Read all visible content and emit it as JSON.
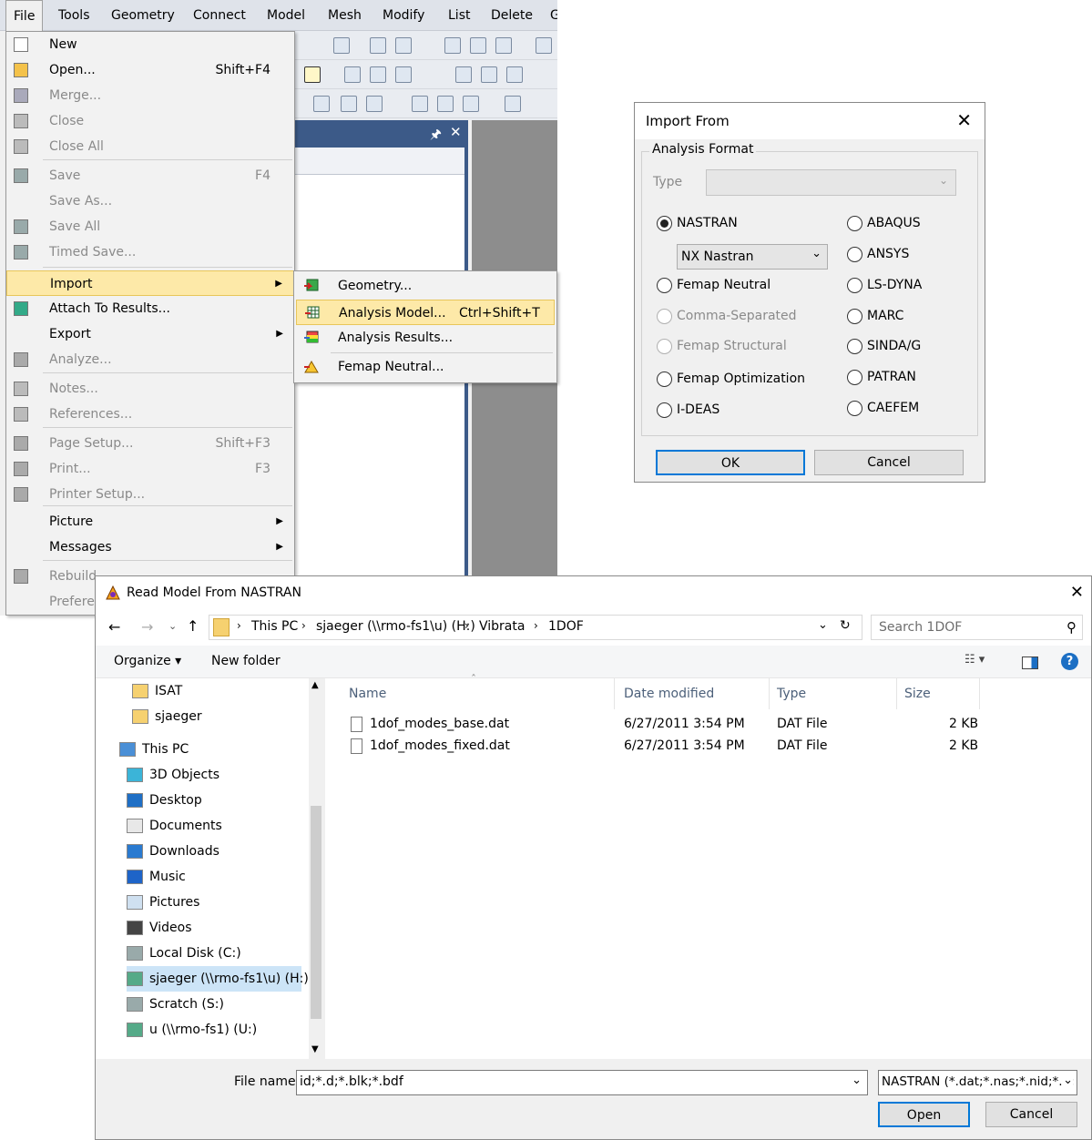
{
  "menubar": [
    "File",
    "Tools",
    "Geometry",
    "Connect",
    "Model",
    "Mesh",
    "Modify",
    "List",
    "Delete",
    "G"
  ],
  "file_menu": [
    {
      "label": "New",
      "shortcut": "",
      "disabled": false,
      "icon": "new-file-icon"
    },
    {
      "label": "Open...",
      "shortcut": "Shift+F4",
      "disabled": false,
      "icon": "open-folder-icon"
    },
    {
      "label": "Merge...",
      "shortcut": "",
      "disabled": true,
      "icon": "merge-icon"
    },
    {
      "label": "Close",
      "shortcut": "",
      "disabled": true,
      "icon": "close-folder-icon"
    },
    {
      "label": "Close All",
      "shortcut": "",
      "disabled": true,
      "icon": "close-all-icon"
    },
    {
      "label": "Save",
      "shortcut": "F4",
      "disabled": true,
      "icon": "save-icon"
    },
    {
      "label": "Save As...",
      "shortcut": "",
      "disabled": true,
      "icon": ""
    },
    {
      "label": "Save All",
      "shortcut": "",
      "disabled": true,
      "icon": "save-all-icon"
    },
    {
      "label": "Timed Save...",
      "shortcut": "",
      "disabled": true,
      "icon": "timed-save-icon"
    },
    {
      "label": "Import",
      "shortcut": "",
      "disabled": false,
      "icon": ""
    },
    {
      "label": "Attach To Results...",
      "shortcut": "",
      "disabled": false,
      "icon": "attach-results-icon"
    },
    {
      "label": "Export",
      "shortcut": "",
      "disabled": false,
      "icon": ""
    },
    {
      "label": "Analyze...",
      "shortcut": "",
      "disabled": true,
      "icon": "analyze-icon"
    },
    {
      "label": "Notes...",
      "shortcut": "",
      "disabled": true,
      "icon": "notes-icon"
    },
    {
      "label": "References...",
      "shortcut": "",
      "disabled": true,
      "icon": "references-icon"
    },
    {
      "label": "Page Setup...",
      "shortcut": "Shift+F3",
      "disabled": true,
      "icon": "page-setup-icon"
    },
    {
      "label": "Print...",
      "shortcut": "F3",
      "disabled": true,
      "icon": "print-icon"
    },
    {
      "label": "Printer Setup...",
      "shortcut": "",
      "disabled": true,
      "icon": "printer-setup-icon"
    },
    {
      "label": "Picture",
      "shortcut": "",
      "disabled": false,
      "icon": ""
    },
    {
      "label": "Messages",
      "shortcut": "",
      "disabled": false,
      "icon": ""
    },
    {
      "label": "Rebuild",
      "shortcut": "",
      "disabled": true,
      "icon": "rebuild-icon"
    },
    {
      "label": "Prefere",
      "shortcut": "",
      "disabled": true,
      "icon": ""
    }
  ],
  "import_submenu": [
    {
      "label": "Geometry...",
      "shortcut": ""
    },
    {
      "label": "Analysis Model...",
      "shortcut": "Ctrl+Shift+T"
    },
    {
      "label": "Analysis Results...",
      "shortcut": ""
    },
    {
      "label": "Femap Neutral...",
      "shortcut": ""
    }
  ],
  "import_dialog": {
    "title": "Import From",
    "group": "Analysis Format",
    "type_label": "Type",
    "selected": "NASTRAN",
    "nastran_variant": "NX Nastran",
    "left_options": [
      "NASTRAN",
      "Femap Neutral",
      "Comma-Separated",
      "Femap Structural",
      "Femap Optimization",
      "I-DEAS"
    ],
    "right_options": [
      "ABAQUS",
      "ANSYS",
      "LS-DYNA",
      "MARC",
      "SINDA/G",
      "PATRAN",
      "CAEFEM"
    ],
    "ok": "OK",
    "cancel": "Cancel"
  },
  "file_dialog": {
    "title": "Read Model From NASTRAN",
    "path": [
      "This PC",
      "sjaeger (\\\\rmo-fs1\\u) (H:)",
      "Vibrata",
      "1DOF"
    ],
    "search_placeholder": "Search 1DOF",
    "organize": "Organize ▾",
    "new_folder": "New folder",
    "tree": [
      {
        "label": "ISAT",
        "icon": "folder-icon"
      },
      {
        "label": "sjaeger",
        "icon": "folder-icon"
      },
      {
        "label": "This PC",
        "icon": "computer-icon"
      },
      {
        "label": "3D Objects",
        "icon": "3d-objects-icon"
      },
      {
        "label": "Desktop",
        "icon": "desktop-icon"
      },
      {
        "label": "Documents",
        "icon": "documents-icon"
      },
      {
        "label": "Downloads",
        "icon": "downloads-icon"
      },
      {
        "label": "Music",
        "icon": "music-icon"
      },
      {
        "label": "Pictures",
        "icon": "pictures-icon"
      },
      {
        "label": "Videos",
        "icon": "videos-icon"
      },
      {
        "label": "Local Disk (C:)",
        "icon": "drive-icon"
      },
      {
        "label": "sjaeger (\\\\rmo-fs1\\u) (H:)",
        "icon": "network-drive-icon"
      },
      {
        "label": "Scratch (S:)",
        "icon": "drive-icon"
      },
      {
        "label": "u (\\\\rmo-fs1) (U:)",
        "icon": "network-drive-icon"
      }
    ],
    "columns": [
      "Name",
      "Date modified",
      "Type",
      "Size"
    ],
    "files": [
      {
        "name": "1dof_modes_base.dat",
        "date": "6/27/2011 3:54 PM",
        "type": "DAT File",
        "size": "2 KB"
      },
      {
        "name": "1dof_modes_fixed.dat",
        "date": "6/27/2011 3:54 PM",
        "type": "DAT File",
        "size": "2 KB"
      }
    ],
    "filename_label": "File name:",
    "filename_value": "id;*.d;*.blk;*.bdf",
    "filter": "NASTRAN (*.dat;*.nas;*.nid;*.d;",
    "open": "Open",
    "cancel": "Cancel"
  },
  "colors": {
    "highlight": "#fde9a8",
    "accent": "#0078d7",
    "panel": "#3c5a88"
  }
}
